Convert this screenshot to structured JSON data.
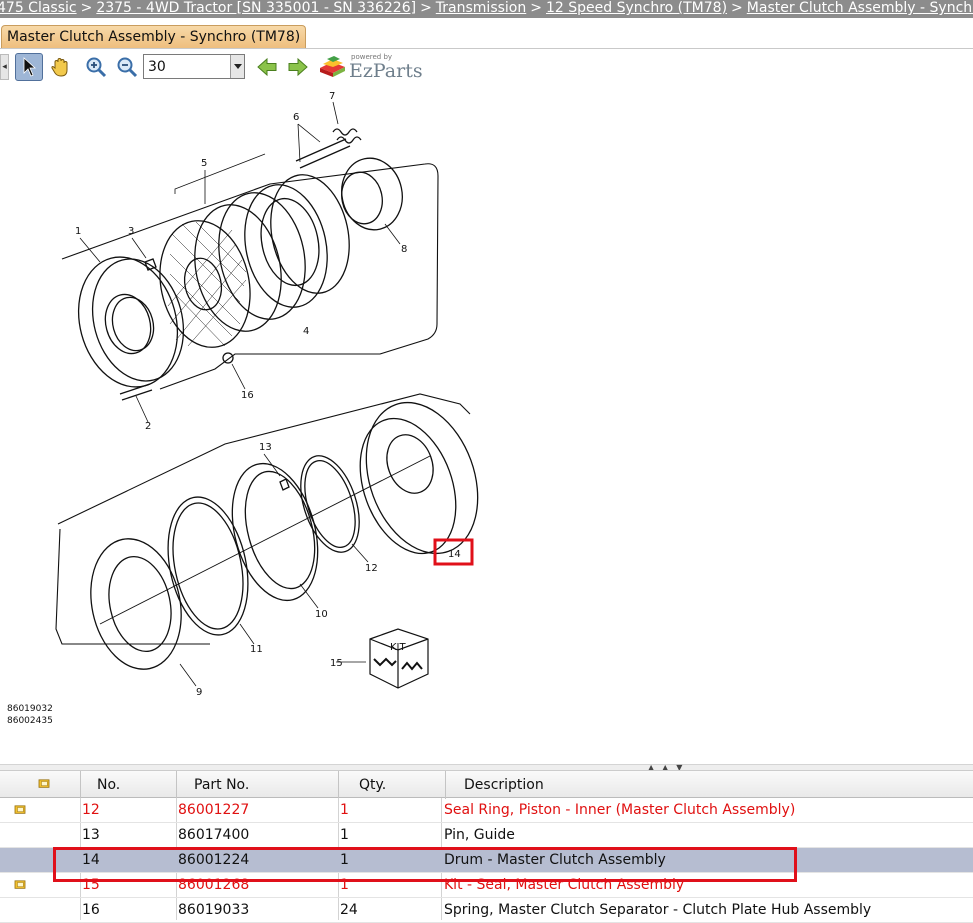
{
  "breadcrumb": {
    "items": [
      "475 Classic",
      "2375 - 4WD Tractor [SN 335001 - SN 336226]",
      "Transmission",
      "12 Speed Synchro (TM78)",
      "Master Clutch Assembly - Synchro (TM78)"
    ],
    "separator": ">"
  },
  "tab": {
    "label": "Master Clutch Assembly - Synchro (TM78)"
  },
  "toolbar": {
    "zoom_value": "30",
    "logo_powered": "powered by",
    "logo_name": "EzParts",
    "icons": [
      "scroll-left-icon",
      "pointer-icon",
      "hand-pan-icon",
      "zoom-in-icon",
      "zoom-out-icon",
      "arrow-back-icon",
      "arrow-forward-icon",
      "ezparts-logo-icon"
    ]
  },
  "diagram": {
    "callouts": [
      "1",
      "2",
      "3",
      "4",
      "5",
      "6",
      "7",
      "8",
      "9",
      "10",
      "11",
      "12",
      "13",
      "14",
      "15",
      "16"
    ],
    "kit_label": "KIT",
    "codes": [
      "86019032",
      "86002435"
    ]
  },
  "table": {
    "headers": {
      "no": "No.",
      "part_no": "Part No.",
      "qty": "Qty.",
      "description": "Description"
    },
    "rows": [
      {
        "no": "12",
        "part_no": "86001227",
        "qty": "1",
        "description": "Seal Ring, Piston - Inner (Master Clutch Assembly)",
        "status": "red"
      },
      {
        "no": "13",
        "part_no": "86017400",
        "qty": "1",
        "description": "Pin, Guide",
        "status": "normal"
      },
      {
        "no": "14",
        "part_no": "86001224",
        "qty": "1",
        "description": "Drum - Master Clutch Assembly",
        "status": "selected"
      },
      {
        "no": "15",
        "part_no": "86001268",
        "qty": "1",
        "description": "Kit - Seal, Master Clutch Assembly",
        "status": "red"
      },
      {
        "no": "16",
        "part_no": "86019033",
        "qty": "24",
        "description": "Spring, Master Clutch Separator - Clutch Plate Hub Assembly",
        "status": "normal"
      }
    ]
  },
  "colors": {
    "breadcrumb_bg": "#8c8c8c",
    "tab_bg": "#eebd7c",
    "selected_row": "#b6bdd1",
    "highlight": "#e0101a",
    "red_text": "#e01010"
  }
}
